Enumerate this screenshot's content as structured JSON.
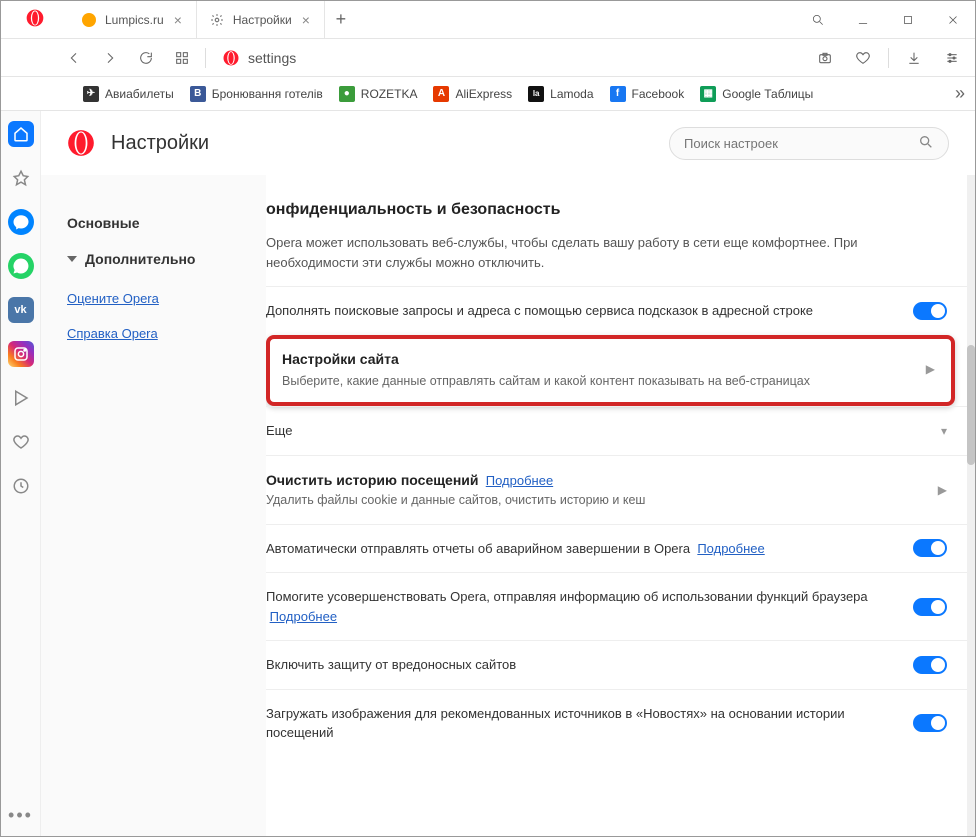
{
  "tabs": [
    {
      "title": "Lumpics.ru"
    },
    {
      "title": "Настройки"
    }
  ],
  "address": "settings",
  "bookmarks": [
    {
      "label": "Авиабилеты",
      "bg": "#333",
      "glyph": "✈"
    },
    {
      "label": "Бронювання готелів",
      "bg": "#3b5998",
      "glyph": "B"
    },
    {
      "label": "ROZETKA",
      "bg": "#3b9c3b",
      "glyph": "●"
    },
    {
      "label": "AliExpress",
      "bg": "#e63900",
      "glyph": "A"
    },
    {
      "label": "Lamoda",
      "bg": "#111",
      "glyph": "la"
    },
    {
      "label": "Facebook",
      "bg": "#1877f2",
      "glyph": "f"
    },
    {
      "label": "Google Таблицы",
      "bg": "#0f9d58",
      "glyph": "▦"
    }
  ],
  "header": {
    "title": "Настройки"
  },
  "search": {
    "placeholder": "Поиск настроек"
  },
  "nav": {
    "basic": "Основные",
    "advanced": "Дополнительно",
    "rate": "Оцените Opera",
    "help": "Справка Opera"
  },
  "section": {
    "title": "онфиденциальность и безопасность",
    "intro": "Opera может использовать веб-службы, чтобы сделать вашу работу в сети еще комфортнее. При необходимости эти службы можно отключить.",
    "rows": {
      "autocomplete": "Дополнять поисковые запросы и адреса с помощью сервиса подсказок в адресной строке",
      "siteSettingsTitle": "Настройки сайта",
      "siteSettingsSub": "Выберите, какие данные отправлять сайтам и какой контент показывать на веб-страницах",
      "more": "Еще",
      "clearTitle": "Очистить историю посещений",
      "clearLink": "Подробнее",
      "clearSub": "Удалить файлы cookie и данные сайтов, очистить историю и кеш",
      "crash": "Автоматически отправлять отчеты об аварийном завершении в Opera",
      "crashLink": "Подробнее",
      "improve": "Помогите усовершенствовать Opera, отправляя информацию об использовании функций браузера",
      "improveLink": "Подробнее",
      "malware": "Включить защиту от вредоносных сайтов",
      "newsImages": "Загружать изображения для рекомендованных источников в «Новостях» на основании истории посещений"
    }
  }
}
